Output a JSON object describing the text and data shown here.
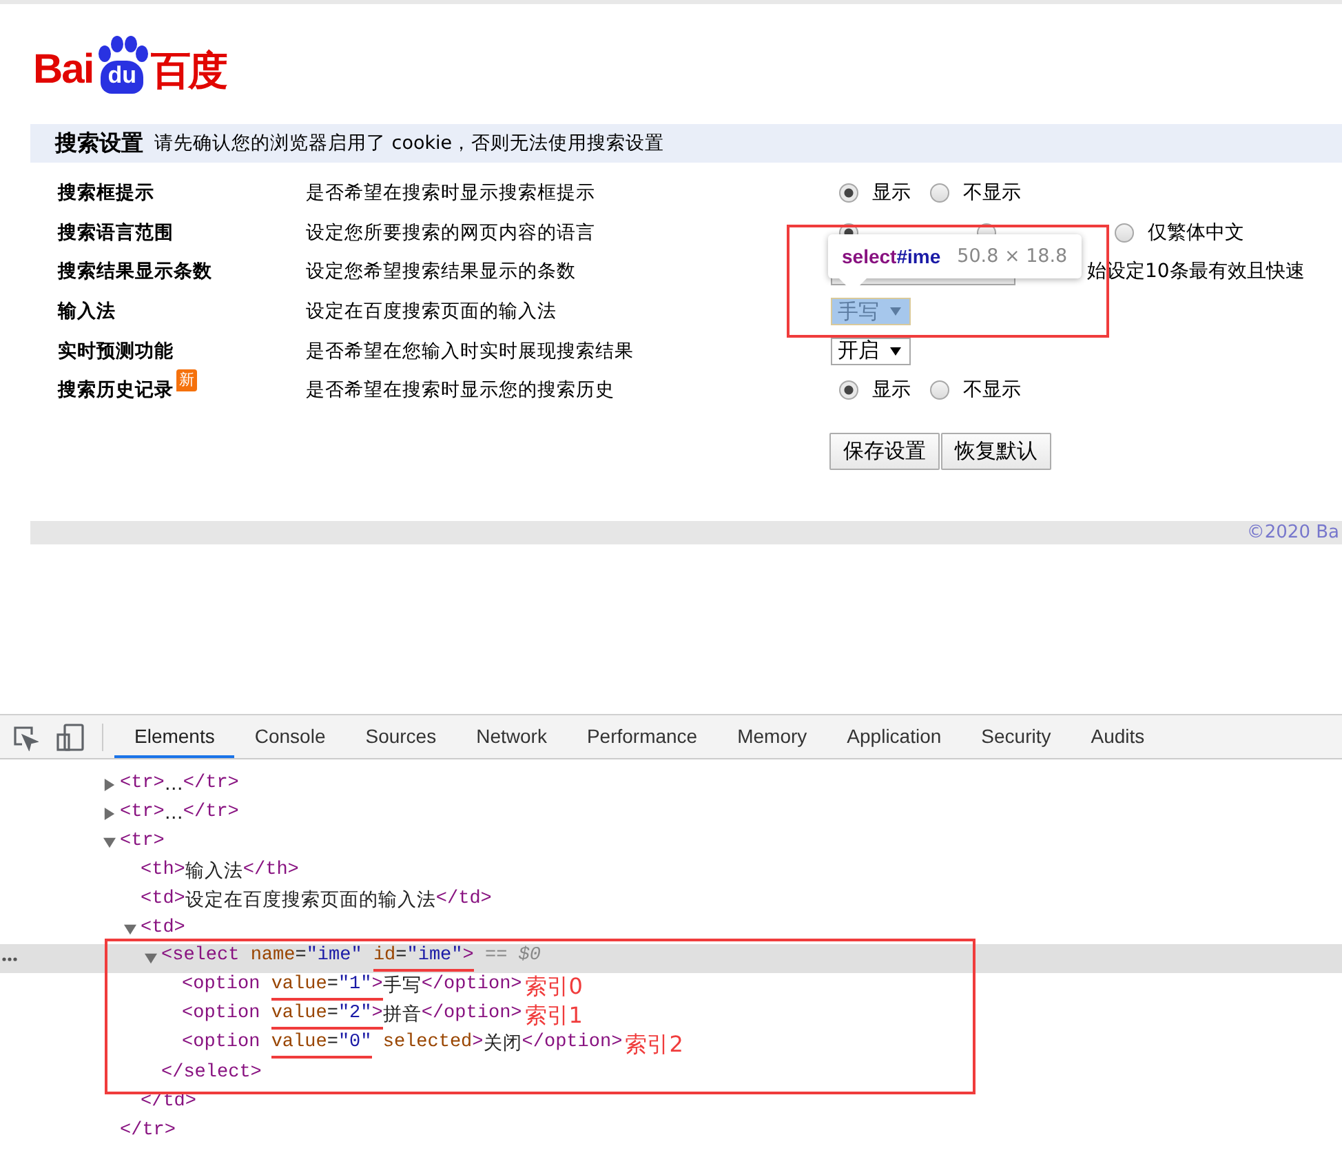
{
  "logo": {
    "latin": "Bai",
    "paw": "du",
    "chinese": "百度"
  },
  "settings": {
    "title": "搜索设置",
    "notice": "请先确认您的浏览器启用了 cookie，否则无法使用搜索设置",
    "rows": [
      {
        "label": "搜索框提示",
        "description": "是否希望在搜索时显示搜索框提示",
        "controls": [
          {
            "kind": "radio",
            "label": "显示",
            "selected": true
          },
          {
            "kind": "radio",
            "label": "不显示",
            "selected": false
          }
        ]
      },
      {
        "label": "搜索语言范围",
        "description": "设定您所要搜索的网页内容的语言",
        "controls": [
          {
            "kind": "radio",
            "selected": true
          },
          {
            "kind": "radio",
            "selected": false
          },
          {
            "kind": "radio",
            "label": "仅繁体中文",
            "selected": false
          }
        ]
      },
      {
        "label": "搜索结果显示条数",
        "description": "设定您希望搜索结果显示的条数",
        "controls": [
          {
            "kind": "select",
            "highlighted": false
          },
          {
            "kind": "note",
            "text": "始设定10条最有效且快速"
          }
        ]
      },
      {
        "label": "输入法",
        "description": "设定在百度搜索页面的输入法",
        "controls": [
          {
            "kind": "select",
            "value": "手写",
            "highlighted": true
          }
        ]
      },
      {
        "label": "实时预测功能",
        "description": "是否希望在您输入时实时展现搜索结果",
        "controls": [
          {
            "kind": "select",
            "value": "开启",
            "highlighted": false
          }
        ]
      },
      {
        "label": "搜索历史记录",
        "badge": "新",
        "description": "是否希望在搜索时显示您的搜索历史",
        "controls": [
          {
            "kind": "radio",
            "label": "显示",
            "selected": true
          },
          {
            "kind": "radio",
            "label": "不显示",
            "selected": false
          }
        ]
      }
    ],
    "buttons": [
      "保存设置",
      "恢复默认"
    ]
  },
  "inspect_tooltip": {
    "tag": "select",
    "id": "#ime",
    "size": "50.8 × 18.8"
  },
  "footer": {
    "copyright": "©2020 Ba"
  },
  "devtools": {
    "tabs": [
      {
        "label": "Elements",
        "selected": true
      },
      {
        "label": "Console",
        "selected": false
      },
      {
        "label": "Sources",
        "selected": false
      },
      {
        "label": "Network",
        "selected": false
      },
      {
        "label": "Performance",
        "selected": false
      },
      {
        "label": "Memory",
        "selected": false
      },
      {
        "label": "Application",
        "selected": false
      },
      {
        "label": "Security",
        "selected": false
      },
      {
        "label": "Audits",
        "selected": false
      }
    ],
    "nodes": [
      {
        "expanded": false,
        "selected": false,
        "parts": [
          {
            "kind": "tag",
            "text": "<tr>"
          },
          {
            "kind": "text",
            "text": "…"
          },
          {
            "kind": "tag",
            "text": "</tr>"
          }
        ]
      },
      {
        "expanded": false,
        "selected": false,
        "parts": [
          {
            "kind": "tag",
            "text": "<tr>"
          },
          {
            "kind": "text",
            "text": "…"
          },
          {
            "kind": "tag",
            "text": "</tr>"
          }
        ]
      },
      {
        "expanded": true,
        "selected": false,
        "parts": [
          {
            "kind": "tag",
            "text": "<tr>"
          }
        ],
        "closing": [
          {
            "kind": "tag",
            "text": "</tr>"
          }
        ],
        "children": [
          {
            "selected": false,
            "parts": [
              {
                "kind": "tag",
                "text": "<th>"
              },
              {
                "kind": "text",
                "text": "输入法"
              },
              {
                "kind": "tag",
                "text": "</th>"
              }
            ]
          },
          {
            "selected": false,
            "parts": [
              {
                "kind": "tag",
                "text": "<td>"
              },
              {
                "kind": "text",
                "text": "设定在百度搜索页面的输入法"
              },
              {
                "kind": "tag",
                "text": "</td>"
              }
            ]
          },
          {
            "expanded": true,
            "selected": false,
            "parts": [
              {
                "kind": "tag",
                "text": "<td>"
              }
            ],
            "closing": [
              {
                "kind": "tag",
                "text": "</td>"
              }
            ],
            "children": [
              {
                "expanded": true,
                "selected": true,
                "boxed": true,
                "parts": [
                  {
                    "kind": "tag",
                    "text": "<select"
                  },
                  {
                    "kind": "attr",
                    "text": "name"
                  },
                  {
                    "kind": "punct",
                    "text": "="
                  },
                  {
                    "kind": "value",
                    "text": "\"ime\""
                  },
                  {
                    "kind": "attr",
                    "text": "id",
                    "underlined": true
                  },
                  {
                    "kind": "punct",
                    "text": "=",
                    "underlined": true
                  },
                  {
                    "kind": "value",
                    "text": "\"ime\"",
                    "underlined": true
                  },
                  {
                    "kind": "tag",
                    "text": ">",
                    "underlined": true
                  },
                  {
                    "kind": "note",
                    "text": "== $0"
                  }
                ],
                "closing": [
                  {
                    "kind": "tag",
                    "text": "</select>"
                  }
                ],
                "children": [
                  {
                    "selected": false,
                    "annotation": "索引0",
                    "parts": [
                      {
                        "kind": "tag",
                        "text": "<option"
                      },
                      {
                        "kind": "attr",
                        "text": "value",
                        "underlined": true
                      },
                      {
                        "kind": "punct",
                        "text": "=",
                        "underlined": true
                      },
                      {
                        "kind": "value",
                        "text": "\"1\"",
                        "underlined": true
                      },
                      {
                        "kind": "tag",
                        "text": ">",
                        "underlined": true
                      },
                      {
                        "kind": "text",
                        "text": "手写"
                      },
                      {
                        "kind": "tag",
                        "text": "</option>"
                      }
                    ]
                  },
                  {
                    "selected": false,
                    "annotation": "索引1",
                    "parts": [
                      {
                        "kind": "tag",
                        "text": "<option"
                      },
                      {
                        "kind": "attr",
                        "text": "value",
                        "underlined": true
                      },
                      {
                        "kind": "punct",
                        "text": "=",
                        "underlined": true
                      },
                      {
                        "kind": "value",
                        "text": "\"2\"",
                        "underlined": true
                      },
                      {
                        "kind": "tag",
                        "text": ">",
                        "underlined": true
                      },
                      {
                        "kind": "text",
                        "text": "拼音"
                      },
                      {
                        "kind": "tag",
                        "text": "</option>"
                      }
                    ]
                  },
                  {
                    "selected": false,
                    "annotation": "索引2",
                    "parts": [
                      {
                        "kind": "tag",
                        "text": "<option"
                      },
                      {
                        "kind": "attr",
                        "text": "value",
                        "underlined": true
                      },
                      {
                        "kind": "punct",
                        "text": "=",
                        "underlined": true
                      },
                      {
                        "kind": "value",
                        "text": "\"0\"",
                        "underlined": true
                      },
                      {
                        "kind": "attr",
                        "text": "selected"
                      },
                      {
                        "kind": "tag",
                        "text": ">"
                      },
                      {
                        "kind": "text",
                        "text": "关闭"
                      },
                      {
                        "kind": "tag",
                        "text": "</option>"
                      }
                    ]
                  }
                ]
              }
            ]
          }
        ]
      }
    ]
  }
}
